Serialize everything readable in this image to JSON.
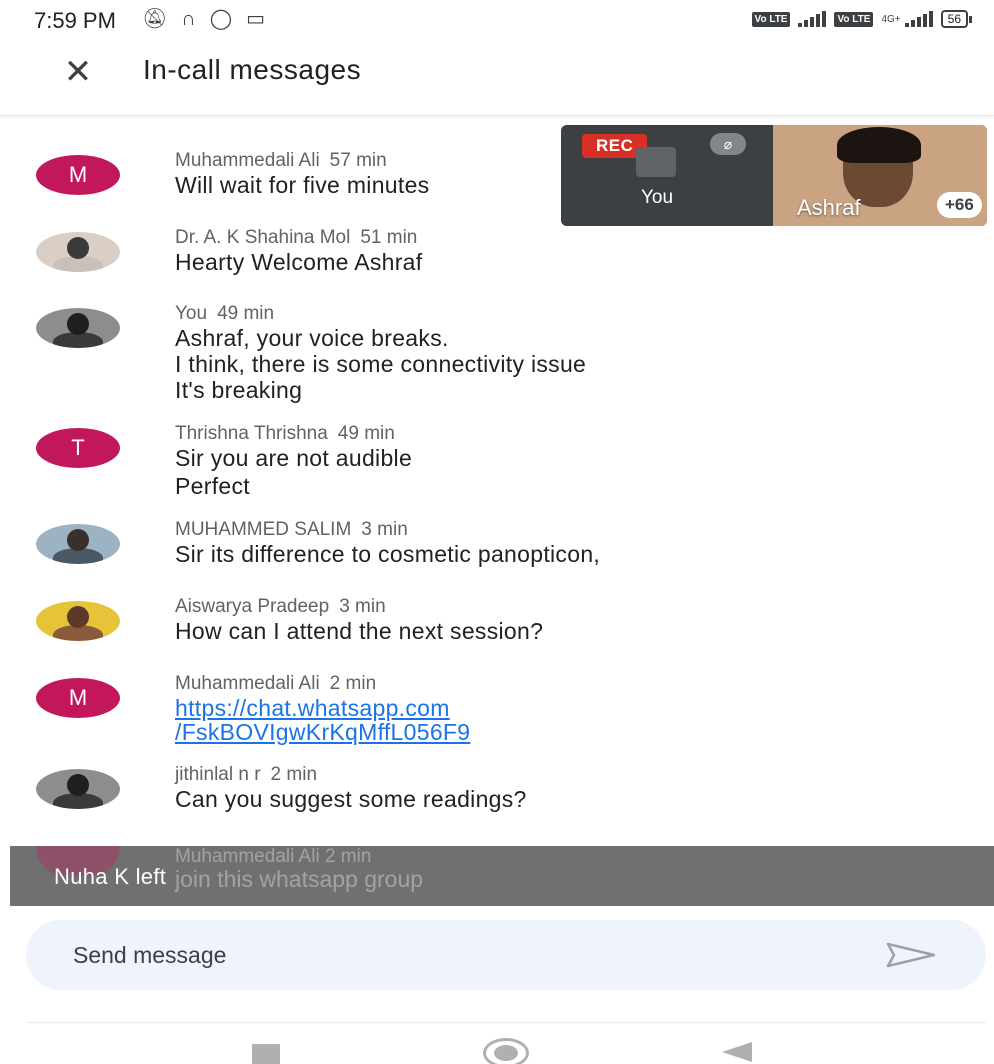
{
  "status_bar": {
    "time": "7:59 PM",
    "icons": [
      "notifications-off-icon",
      "headset-icon",
      "whatsapp-icon",
      "video-icon"
    ],
    "volte_label": "Vo LTE",
    "network_label": "4G+",
    "battery": "56"
  },
  "header": {
    "close_icon": "close-icon",
    "title": "In-call messages"
  },
  "video": {
    "rec_label": "REC",
    "self_label": "You",
    "remote_label": "Ashraf",
    "more_count": "+66"
  },
  "messages": [
    {
      "sender": "Muhammedali Ali",
      "time": "57 min",
      "avatar_letter": "M",
      "lines": [
        "Will wait for five minutes"
      ]
    },
    {
      "sender": "Dr. A. K Shahina Mol",
      "time": "51 min",
      "avatar_letter": "",
      "lines": [
        "Hearty Welcome Ashraf"
      ]
    },
    {
      "sender": "You",
      "time": "49 min",
      "avatar_letter": "",
      "lines": [
        "Ashraf, your voice breaks.",
        "I think, there is some connectivity issue",
        "It's breaking"
      ]
    },
    {
      "sender": "Thrishna Thrishna",
      "time": "49 min",
      "avatar_letter": "T",
      "lines": [
        "Sir you are not audible",
        "Perfect"
      ]
    },
    {
      "sender": "MUHAMMED SALIM",
      "time": "3 min",
      "avatar_letter": "",
      "lines": [
        "Sir its difference to cosmetic panopticon,"
      ]
    },
    {
      "sender": "Aiswarya Pradeep",
      "time": "3 min",
      "avatar_letter": "",
      "lines": [
        "How can I attend the next session?"
      ]
    },
    {
      "sender": "Muhammedali Ali",
      "time": "2 min",
      "avatar_letter": "M",
      "lines": [
        "https://chat.whatsapp.com",
        "/FskBOVIgwKrKqMffL056F9"
      ]
    },
    {
      "sender": "jithinlal n r",
      "time": "2 min",
      "avatar_letter": "",
      "lines": [
        "Can you suggest some readings?"
      ]
    },
    {
      "sender": "Muhammedali Ali",
      "time": "2 min",
      "avatar_letter": "M",
      "lines": [
        "join this whatsapp group"
      ]
    }
  ],
  "toast": {
    "text": "Nuha K left"
  },
  "composer": {
    "placeholder": "Send message",
    "send_icon": "send-icon"
  },
  "nav": {
    "recents_icon": "recents-icon",
    "home_icon": "home-icon",
    "back_icon": "back-icon"
  }
}
